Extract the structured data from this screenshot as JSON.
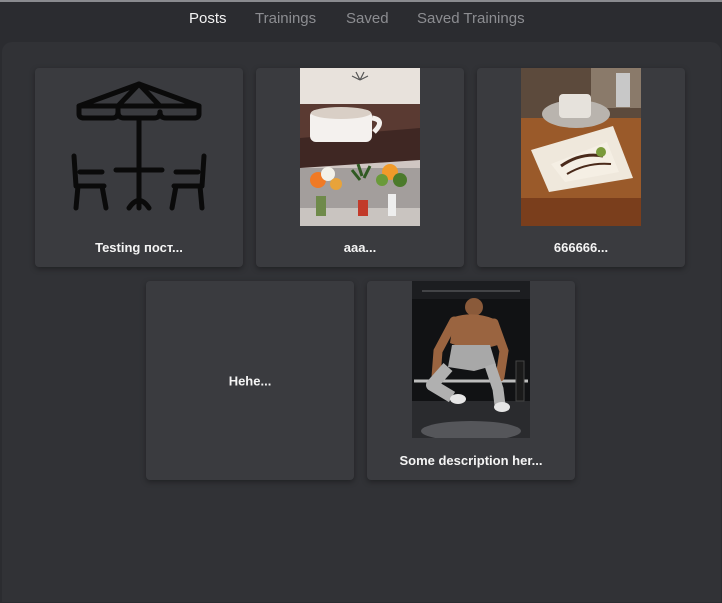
{
  "tabs": [
    {
      "label": "Posts",
      "active": true
    },
    {
      "label": "Trainings",
      "active": false
    },
    {
      "label": "Saved",
      "active": false
    },
    {
      "label": "Saved Trainings",
      "active": false
    }
  ],
  "posts": [
    {
      "caption": "Testing пост...",
      "image": "cafe-table-umbrella-icon"
    },
    {
      "caption": "aaa...",
      "image": "coffee-cup-flowers-photo"
    },
    {
      "caption": "666666...",
      "image": "cake-dessert-photo"
    },
    {
      "caption": "Hehe...",
      "image": null
    },
    {
      "caption": "Some description her...",
      "image": "athlete-barbell-photo"
    }
  ],
  "colors": {
    "background": "#2b2c30",
    "panel": "#313236",
    "card": "#3a3b3f",
    "tab_active": "#f2f2f2",
    "tab_inactive": "#8c8d91"
  }
}
